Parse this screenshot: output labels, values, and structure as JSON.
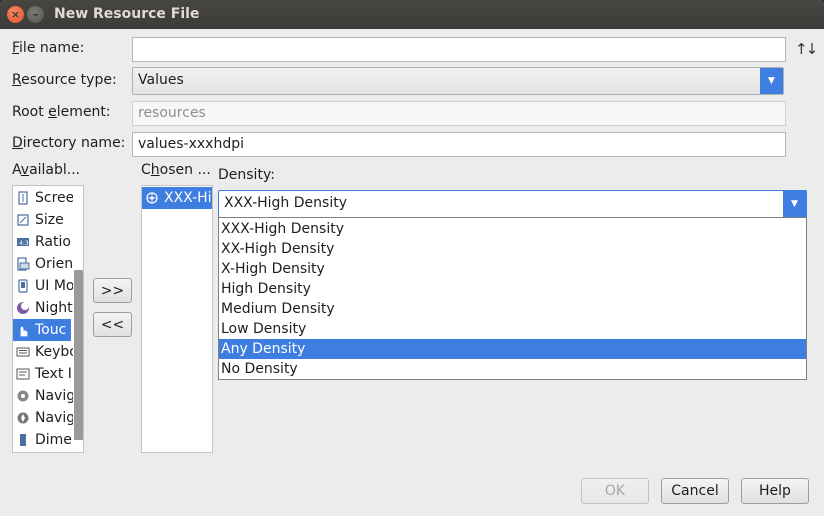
{
  "window": {
    "title": "New Resource File"
  },
  "form": {
    "file_name": {
      "label_prefix": "",
      "label_mnemonic": "F",
      "label_rest": "ile name:",
      "value": ""
    },
    "resource_type": {
      "label_mnemonic": "R",
      "label_rest": "esource type:",
      "value": "Values"
    },
    "root_element": {
      "label_prefix": "Root ",
      "label_mnemonic": "e",
      "label_rest": "lement:",
      "value": "resources"
    },
    "directory_name": {
      "label_mnemonic": "D",
      "label_rest": "irectory name:",
      "value": "values-xxxhdpi"
    }
  },
  "available": {
    "label_prefix": "A",
    "label_mnemonic": "v",
    "label_rest": "ailabl...",
    "items": [
      {
        "label": "Scree",
        "icon": "screen-size-icon"
      },
      {
        "label": "Size",
        "icon": "size-icon"
      },
      {
        "label": "Ratio",
        "icon": "ratio-icon"
      },
      {
        "label": "Orien",
        "icon": "orientation-icon"
      },
      {
        "label": "UI Mo",
        "icon": "ui-mode-icon"
      },
      {
        "label": "Night",
        "icon": "night-mode-icon"
      },
      {
        "label": "Touc",
        "icon": "touch-icon"
      },
      {
        "label": "Keybo",
        "icon": "keyboard-icon"
      },
      {
        "label": "Text I",
        "icon": "text-input-icon"
      },
      {
        "label": "Navig",
        "icon": "navigation-state-icon"
      },
      {
        "label": "Navig",
        "icon": "navigation-method-icon"
      },
      {
        "label": "Dime",
        "icon": "dimension-icon"
      }
    ],
    "selected_index": 6
  },
  "buttons": {
    "add": ">>",
    "remove": "<<",
    "ok": "OK",
    "cancel": "Cancel",
    "help": "Help"
  },
  "chosen": {
    "label_prefix": "C",
    "label_mnemonic": "h",
    "label_rest": "osen ...",
    "items": [
      {
        "label": "XXX-Hig",
        "icon": "density-icon"
      }
    ]
  },
  "density": {
    "label": "Density:",
    "selected": "XXX-High Density",
    "options": [
      "XXX-High Density",
      "XX-High Density",
      "X-High Density",
      "High Density",
      "Medium Density",
      "Low Density",
      "Any Density",
      "No Density"
    ],
    "highlighted_index": 6
  },
  "colors": {
    "accent": "#3d7ee0",
    "dialog_bg": "#ececec",
    "titlebar": "#3c3b37",
    "close_button": "#e1501f"
  }
}
